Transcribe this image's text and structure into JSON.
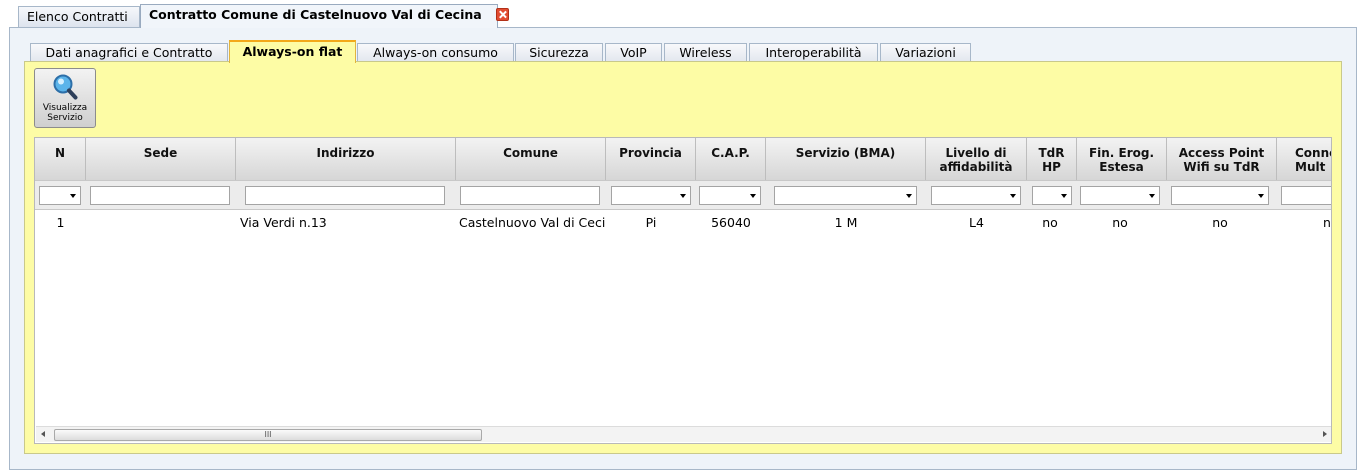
{
  "outer_tabs": [
    {
      "label": "Elenco Contratti",
      "active": false
    },
    {
      "label": "Contratto Comune di Castelnuovo Val di Cecina",
      "active": true
    }
  ],
  "inner_tabs": [
    {
      "label": "Dati anagrafici e Contratto",
      "active": false
    },
    {
      "label": "Always-on flat",
      "active": true
    },
    {
      "label": "Always-on consumo",
      "active": false
    },
    {
      "label": "Sicurezza",
      "active": false
    },
    {
      "label": "VoIP",
      "active": false
    },
    {
      "label": "Wireless",
      "active": false
    },
    {
      "label": "Interoperabilità",
      "active": false
    },
    {
      "label": "Variazioni",
      "active": false
    }
  ],
  "toolbar": {
    "view_service_line1": "Visualizza",
    "view_service_line2": "Servizio"
  },
  "grid": {
    "columns": [
      {
        "l1": "N",
        "l2": ""
      },
      {
        "l1": "Sede",
        "l2": ""
      },
      {
        "l1": "Indirizzo",
        "l2": ""
      },
      {
        "l1": "Comune",
        "l2": ""
      },
      {
        "l1": "Provincia",
        "l2": ""
      },
      {
        "l1": "C.A.P.",
        "l2": ""
      },
      {
        "l1": "Servizio (BMA)",
        "l2": ""
      },
      {
        "l1": "Livello di",
        "l2": "affidabilità"
      },
      {
        "l1": "TdR",
        "l2": "HP"
      },
      {
        "l1": "Fin. Erog.",
        "l2": "Estesa"
      },
      {
        "l1": "Access Point",
        "l2": "Wifi su TdR"
      },
      {
        "l1": "Conne",
        "l2": "Mult"
      }
    ],
    "rows": [
      [
        "1",
        "",
        "Via Verdi n.13",
        "Castelnuovo Val di Ceci",
        "Pi",
        "56040",
        "1 M",
        "L4",
        "no",
        "no",
        "no",
        "n"
      ]
    ],
    "scroll_thumb_label": "III"
  },
  "colors": {
    "active_tab_panel": "#fdfca5",
    "active_tab_border": "#f3a91a",
    "close_icon": "#e24c31"
  }
}
